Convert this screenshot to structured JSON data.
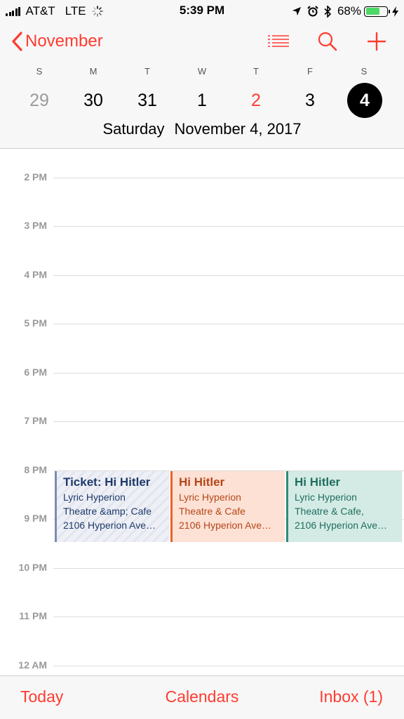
{
  "status_bar": {
    "carrier": "AT&T",
    "network": "LTE",
    "time": "5:39 PM",
    "battery": "68%",
    "battery_level": 0.68,
    "battery_color": "#4cd964",
    "icons": [
      "signal-icon",
      "loading-spinner-icon",
      "location-arrow-icon",
      "alarm-icon",
      "bluetooth-icon",
      "battery-icon",
      "charging-bolt-icon"
    ]
  },
  "header": {
    "back_label": "November",
    "accent_color": "#ff3b30",
    "icons": [
      "chevron-left-icon",
      "list-view-icon",
      "search-icon",
      "add-icon"
    ],
    "weekdays": [
      "S",
      "M",
      "T",
      "W",
      "T",
      "F",
      "S"
    ],
    "dates": [
      "29",
      "30",
      "31",
      "1",
      "2",
      "3",
      "4"
    ],
    "weekday_name": "Saturday",
    "full_date": "November 4, 2017"
  },
  "timeline": {
    "hours": [
      "2 PM",
      "3 PM",
      "4 PM",
      "5 PM",
      "6 PM",
      "7 PM",
      "8 PM",
      "9 PM",
      "10 PM",
      "11 PM",
      "12 AM"
    ]
  },
  "events": [
    {
      "title": "Ticket: Hi Hitler",
      "line1": "Lyric Hyperion",
      "line2": "Theatre &amp; Cafe",
      "line3": "2106 Hyperion Ave…",
      "color": "#7b8db0"
    },
    {
      "title": "Hi Hitler",
      "line1": "Lyric Hyperion",
      "line2": "Theatre & Cafe",
      "line3": "2106 Hyperion Ave…",
      "color": "#e8642b"
    },
    {
      "title": "Hi Hitler",
      "line1": "Lyric Hyperion",
      "line2": "Theatre & Cafe,",
      "line3": "2106 Hyperion Ave…",
      "color": "#2f8a78"
    }
  ],
  "toolbar": {
    "today": "Today",
    "calendars": "Calendars",
    "inbox": "Inbox (1)"
  }
}
